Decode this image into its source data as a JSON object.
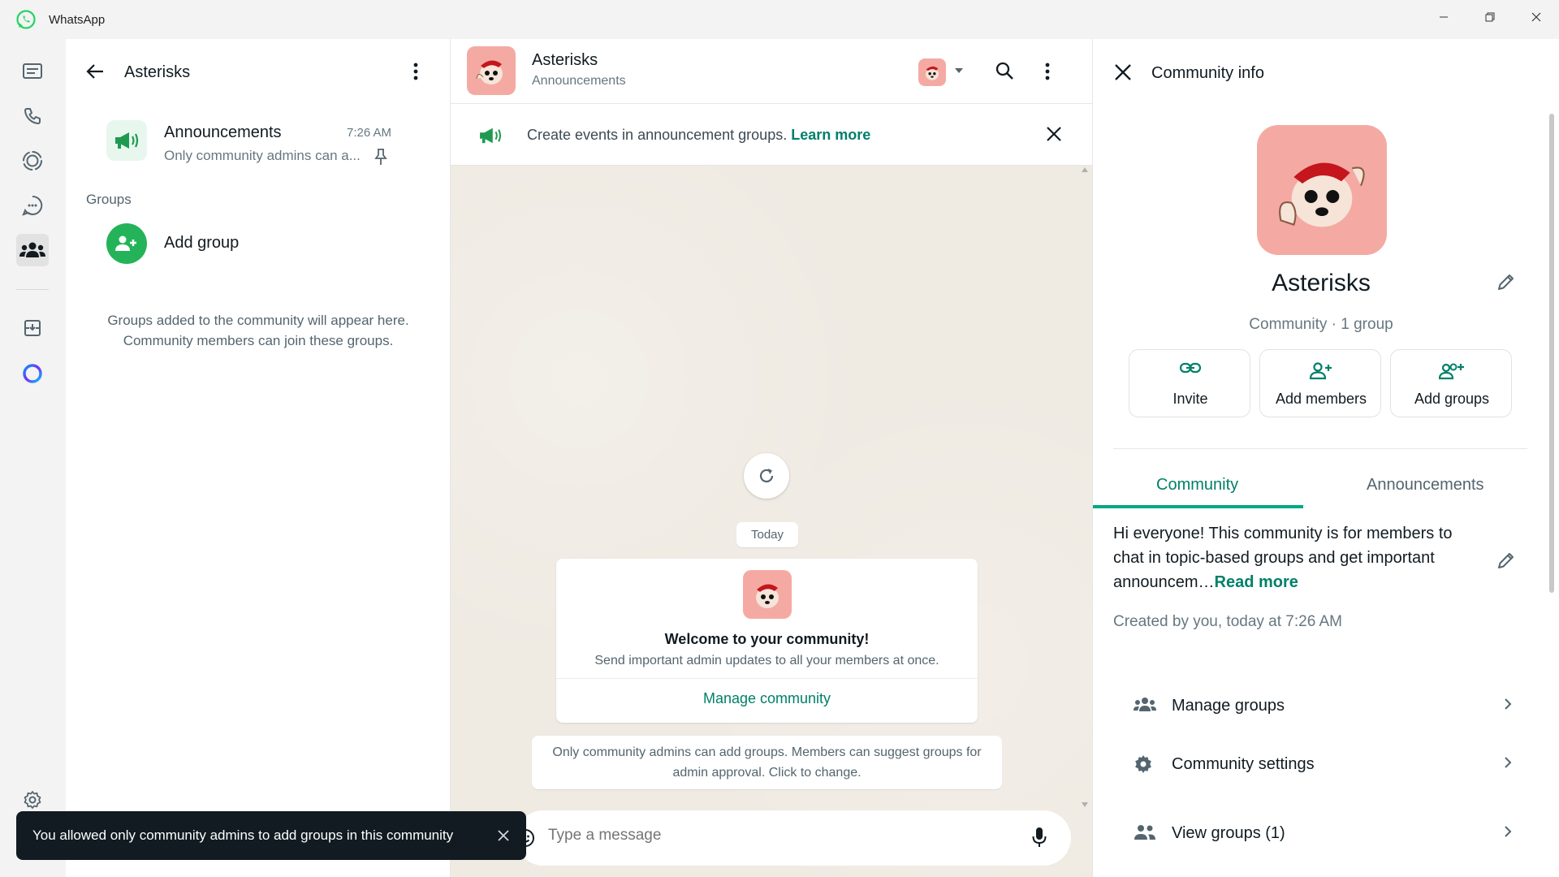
{
  "app": {
    "title": "WhatsApp"
  },
  "colors": {
    "accent": "#008069",
    "green": "#25b35a",
    "avatar_bg": "#f4aaa3"
  },
  "rail": {
    "icons": [
      "chats-icon",
      "calls-icon",
      "status-icon",
      "channels-icon",
      "communities-icon",
      "archived-icon",
      "meta-ai-icon",
      "settings-icon"
    ]
  },
  "community_list": {
    "title": "Asterisks",
    "announcements": {
      "title": "Announcements",
      "time": "7:26 AM",
      "preview": "Only community admins can a..."
    },
    "groups_label": "Groups",
    "add_group_label": "Add group",
    "hint_line1": "Groups added to the community will appear here.",
    "hint_line2": "Community members can join these groups."
  },
  "chat": {
    "title": "Asterisks",
    "subtitle": "Announcements",
    "banner_text": "Create events in announcement groups.",
    "banner_link": "Learn more",
    "date_label": "Today",
    "welcome_title": "Welcome to your community!",
    "welcome_sub": "Send important admin updates to all your members at once.",
    "manage_link": "Manage community",
    "system_line1": "Only community admins can add groups. Members can suggest groups for",
    "system_line2": "admin approval. Click to change.",
    "composer_placeholder": "Type a message"
  },
  "toast": {
    "text": "You allowed only community admins to add groups in this community"
  },
  "info": {
    "title": "Community info",
    "name": "Asterisks",
    "meta": "Community · 1 group",
    "actions": [
      {
        "label": "Invite"
      },
      {
        "label": "Add members"
      },
      {
        "label": "Add groups"
      }
    ],
    "tabs": {
      "community": "Community",
      "announcements": "Announcements"
    },
    "description": "Hi everyone! This community is for members to chat in topic-based groups and get important announcem…",
    "read_more": "Read more",
    "created": "Created by you, today at 7:26 AM",
    "options": [
      {
        "label": "Manage groups"
      },
      {
        "label": "Community settings"
      },
      {
        "label": "View groups (1)"
      }
    ]
  }
}
